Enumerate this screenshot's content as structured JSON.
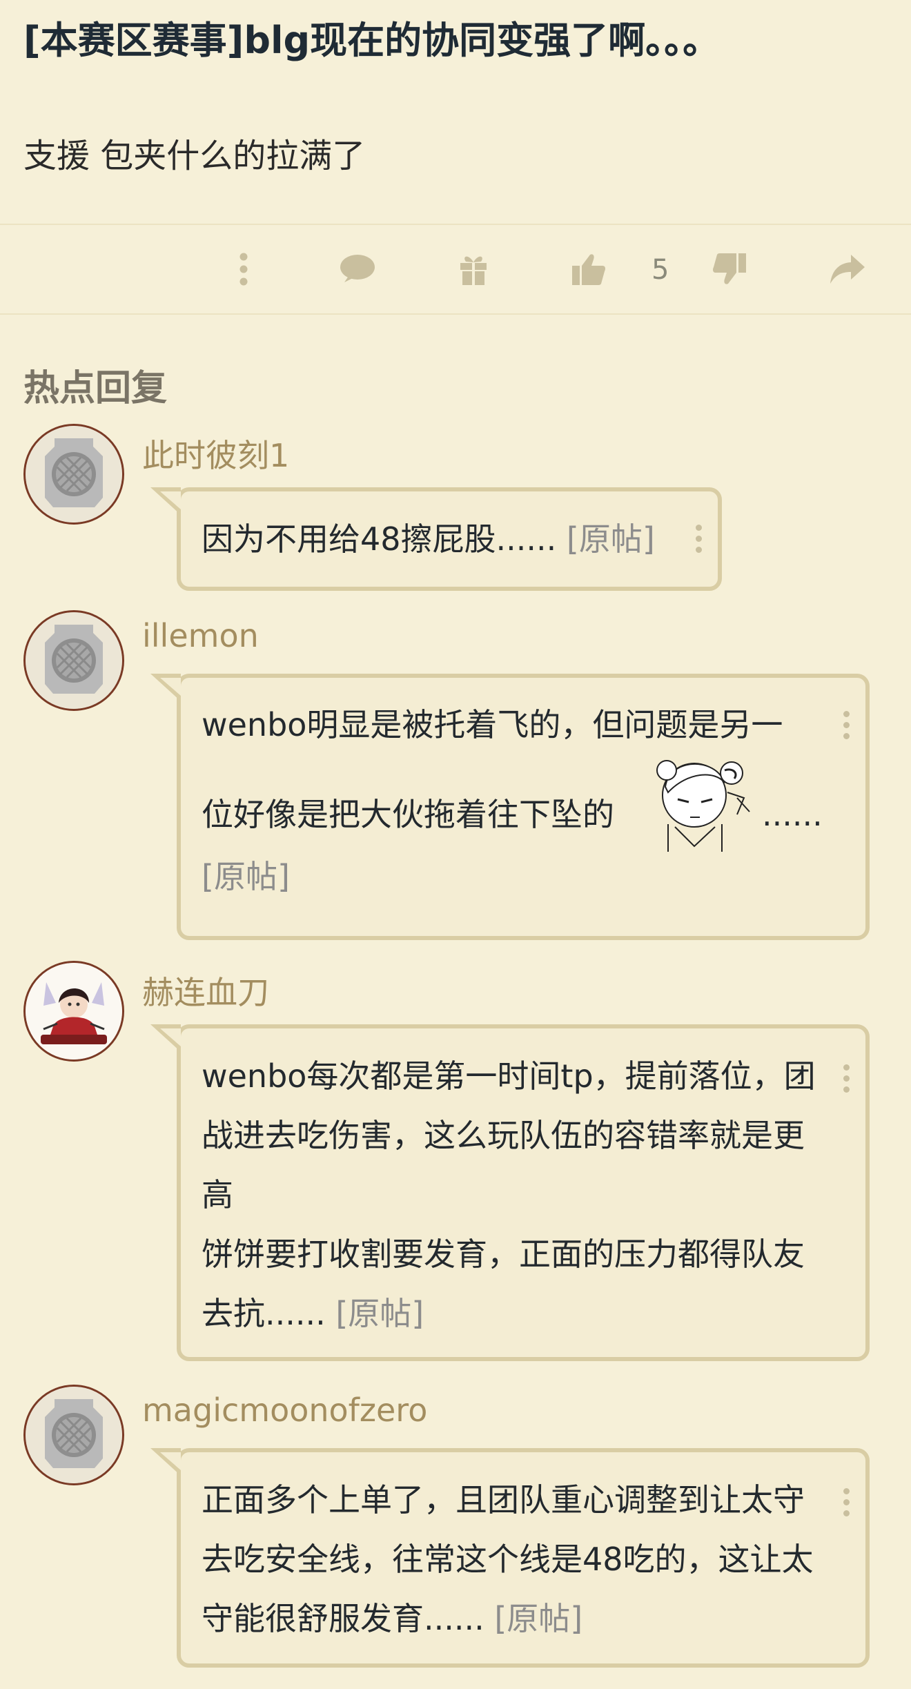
{
  "post": {
    "title": "[本赛区赛事]blg现在的协同变强了啊。。。",
    "body": "支援 包夹什么的拉满了"
  },
  "actions": {
    "like_count": "5",
    "icons": [
      "more-icon",
      "comment-icon",
      "gift-icon",
      "thumbs-up-icon",
      "thumbs-down-icon",
      "share-icon"
    ]
  },
  "hot_replies": {
    "title": "热点回复",
    "items": [
      {
        "username": "此时彼刻1",
        "text": "因为不用给48擦屁股......",
        "orig_link": "[原帖]"
      },
      {
        "username": "illemon",
        "text_line1": "wenbo明显是被托着飞的，但问题是另一",
        "text_line2": "位好像是把大伙拖着往下坠的",
        "text_after_emoji": "......",
        "orig_link": "[原帖]"
      },
      {
        "username": "赫连血刀",
        "text": "wenbo每次都是第一时间tp，提前落位，团战进去吃伤害，这么玩队伍的容错率就是更高",
        "text2": "饼饼要打收割要发育，正面的压力都得队友去抗......",
        "orig_link": "[原帖]"
      },
      {
        "username": "magicmoonofzero",
        "text": "正面多个上单了，且团队重心调整到让太守去吃安全线，往常这个线是48吃的，这让太守能很舒服发育......",
        "orig_link": "[原帖]"
      }
    ]
  },
  "colors": {
    "background": "#f6f0d8",
    "bubble_border": "#d9cda4",
    "username": "#a38d5f",
    "link": "#8c8c8c"
  }
}
